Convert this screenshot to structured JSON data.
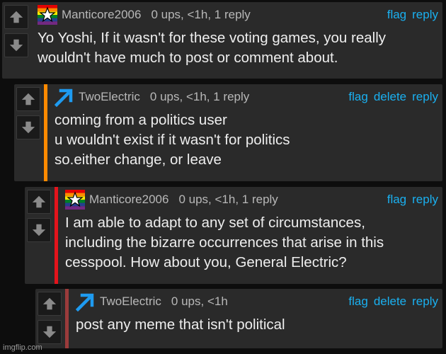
{
  "comments": [
    {
      "username": "Manticore2006",
      "meta": "0 ups, <1h, 1 reply",
      "actions": [
        "flag",
        "reply"
      ],
      "text": "Yo Yoshi, If it wasn't for these voting games, you really\nwouldn't have much to post or comment about.",
      "avatar_icon": "rainbow-star-icon",
      "bar_color": ""
    },
    {
      "username": "TwoElectric",
      "meta": "0 ups, <1h, 1 reply",
      "actions": [
        "flag",
        "delete",
        "reply"
      ],
      "text": "coming from a politics user\nu wouldn't exist if it wasn't for politics\nso.either change, or leave",
      "avatar_icon": "blue-arrow-icon",
      "bar_color": "#ff8a00"
    },
    {
      "username": "Manticore2006",
      "meta": "0 ups, <1h, 1 reply",
      "actions": [
        "flag",
        "reply"
      ],
      "text": "I am able to adapt to any set of circumstances,\nincluding the bizarre occurrences that arise in this\ncesspool. How about you, General Electric?",
      "avatar_icon": "rainbow-star-icon",
      "bar_color": "#e3141c"
    },
    {
      "username": "TwoElectric",
      "meta": "0 ups, <1h",
      "actions": [
        "flag",
        "delete",
        "reply"
      ],
      "text": "post any meme that isn't political",
      "avatar_icon": "blue-arrow-icon",
      "bar_color": "#9b3b3b"
    }
  ],
  "vote_icons": [
    "upvote-arrow-icon",
    "downvote-arrow-icon"
  ],
  "watermark": "imgflip.com",
  "colors": {
    "background": "#0d0d0d",
    "panel": "#2a2a2a",
    "action_link": "#1ab0f0",
    "meta_text": "#b8b8b8",
    "body_text": "#eeeeee"
  }
}
